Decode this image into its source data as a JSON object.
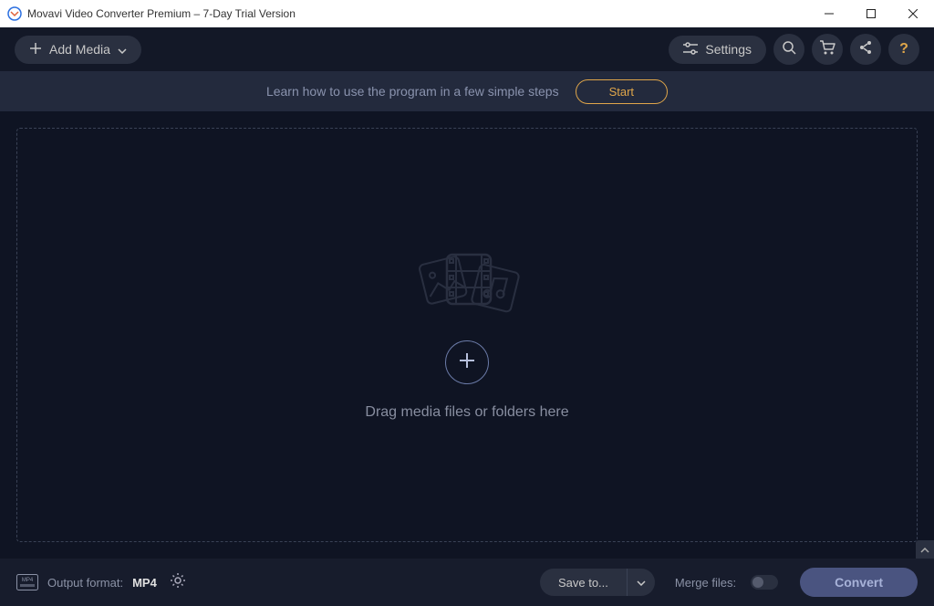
{
  "window": {
    "title": "Movavi Video Converter Premium – 7-Day Trial Version"
  },
  "toolbar": {
    "add_media": "Add Media",
    "settings": "Settings"
  },
  "banner": {
    "text": "Learn how to use the program in a few simple steps",
    "start": "Start"
  },
  "dropzone": {
    "hint": "Drag media files or folders here"
  },
  "bottom": {
    "output_label": "Output format:",
    "output_value": "MP4",
    "save_to": "Save to...",
    "merge_label": "Merge files:",
    "convert": "Convert"
  }
}
